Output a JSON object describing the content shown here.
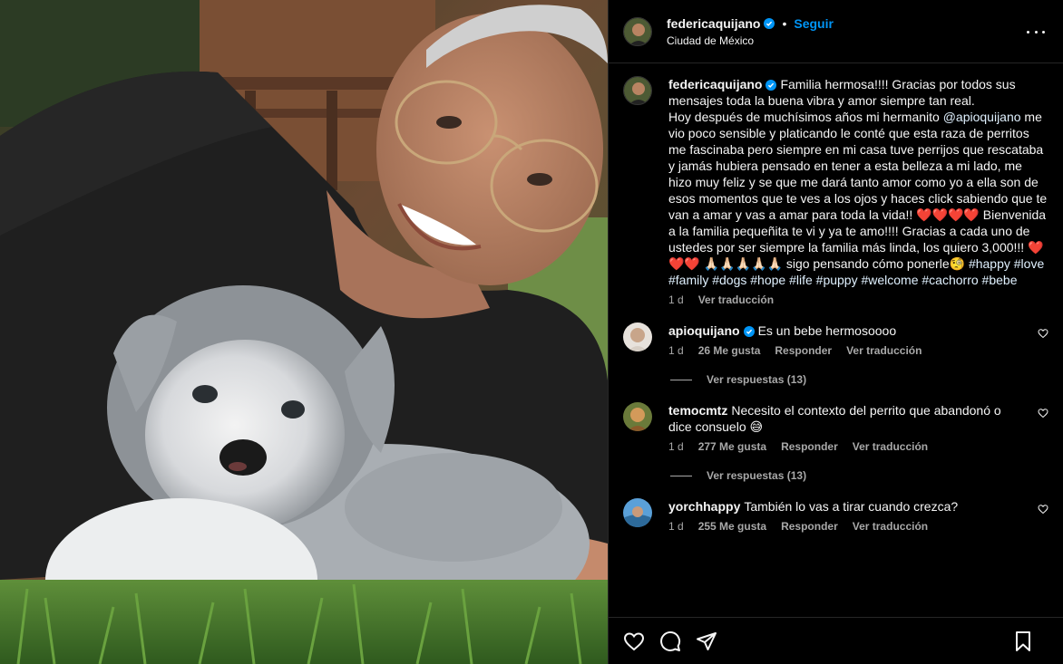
{
  "post": {
    "author": "federicaquijano",
    "location": "Ciudad de México",
    "follow_label": "Seguir",
    "separator": "•"
  },
  "caption": {
    "username": "federicaquijano",
    "line1": "Familia hermosa!!!! Gracias por todos sus mensajes toda la buena vibra y amor siempre tan real.",
    "line2_pre": "Hoy después de muchísimos años mi hermanito ",
    "mention": "@apioquijano",
    "line2_post": " me vio poco sensible y platicando le conté que esta raza de perritos me fascinaba pero siempre en mi casa tuve perrijos que rescataba y jamás hubiera pensado en tener a esta belleza a mi lado, me hizo muy feliz y se que me dará tanto amor como yo a ella son de esos momentos que te ves a los ojos y haces click sabiendo que te van a amar y vas a amar para toda la vida!! ",
    "hearts1": "❤️❤️❤️❤️",
    "line3": " Bienvenida a la familia pequeñita te vi y ya te amo!!!! Gracias a cada uno de ustedes por ser siempre la familia más linda, los quiero 3,000!!! ",
    "hearts2": "❤️❤️❤️",
    "hands": "🙏🏻🙏🏻🙏🏻🙏🏻🙏🏻",
    "line4": " sigo pensando cómo ponerle",
    "thinking": "🧐",
    "hashtags": "#happy #love #family #dogs #hope #life #puppy #welcome #cachorro #bebe",
    "time": "1 d",
    "translate": "Ver traducción"
  },
  "comments": [
    {
      "username": "apioquijano",
      "verified": true,
      "text": "Es un bebe hermosoooo",
      "time": "1 d",
      "likes": "26 Me gusta",
      "reply": "Responder",
      "translate": "Ver traducción",
      "replies": "Ver respuestas (13)"
    },
    {
      "username": "temocmtz",
      "verified": false,
      "text": "Necesito el contexto del perrito que abandonó o dice consuelo ",
      "emoji": "😅",
      "time": "1 d",
      "likes": "277 Me gusta",
      "reply": "Responder",
      "translate": "Ver traducción",
      "replies": "Ver respuestas (13)"
    },
    {
      "username": "yorchhappy",
      "verified": false,
      "text": "También lo vas a tirar cuando crezca?",
      "time": "1 d",
      "likes": "255 Me gusta",
      "reply": "Responder",
      "translate": "Ver traducción"
    }
  ],
  "icons": {
    "verified": "verified-badge-icon",
    "more": "more-options-icon",
    "like": "heart-icon",
    "comment": "comment-bubble-icon",
    "share": "paper-plane-icon",
    "save": "bookmark-icon"
  },
  "colors": {
    "background": "#000000",
    "accent": "#0095f6",
    "muted": "#a8a8a8",
    "divider": "#262626"
  }
}
